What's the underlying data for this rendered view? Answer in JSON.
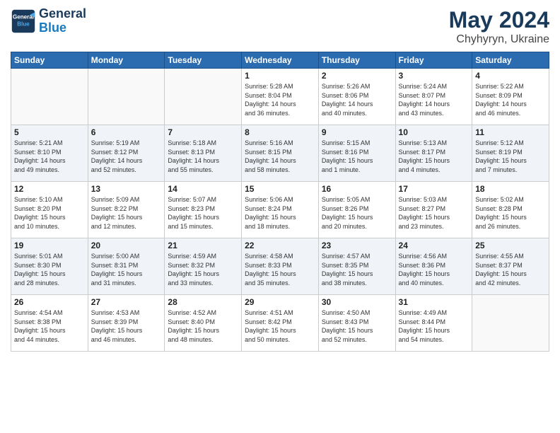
{
  "header": {
    "logo_line1": "General",
    "logo_line2": "Blue",
    "month_year": "May 2024",
    "location": "Chyhyryn, Ukraine"
  },
  "weekdays": [
    "Sunday",
    "Monday",
    "Tuesday",
    "Wednesday",
    "Thursday",
    "Friday",
    "Saturday"
  ],
  "weeks": [
    [
      {
        "day": "",
        "info": ""
      },
      {
        "day": "",
        "info": ""
      },
      {
        "day": "",
        "info": ""
      },
      {
        "day": "1",
        "info": "Sunrise: 5:28 AM\nSunset: 8:04 PM\nDaylight: 14 hours\nand 36 minutes."
      },
      {
        "day": "2",
        "info": "Sunrise: 5:26 AM\nSunset: 8:06 PM\nDaylight: 14 hours\nand 40 minutes."
      },
      {
        "day": "3",
        "info": "Sunrise: 5:24 AM\nSunset: 8:07 PM\nDaylight: 14 hours\nand 43 minutes."
      },
      {
        "day": "4",
        "info": "Sunrise: 5:22 AM\nSunset: 8:09 PM\nDaylight: 14 hours\nand 46 minutes."
      }
    ],
    [
      {
        "day": "5",
        "info": "Sunrise: 5:21 AM\nSunset: 8:10 PM\nDaylight: 14 hours\nand 49 minutes."
      },
      {
        "day": "6",
        "info": "Sunrise: 5:19 AM\nSunset: 8:12 PM\nDaylight: 14 hours\nand 52 minutes."
      },
      {
        "day": "7",
        "info": "Sunrise: 5:18 AM\nSunset: 8:13 PM\nDaylight: 14 hours\nand 55 minutes."
      },
      {
        "day": "8",
        "info": "Sunrise: 5:16 AM\nSunset: 8:15 PM\nDaylight: 14 hours\nand 58 minutes."
      },
      {
        "day": "9",
        "info": "Sunrise: 5:15 AM\nSunset: 8:16 PM\nDaylight: 15 hours\nand 1 minute."
      },
      {
        "day": "10",
        "info": "Sunrise: 5:13 AM\nSunset: 8:17 PM\nDaylight: 15 hours\nand 4 minutes."
      },
      {
        "day": "11",
        "info": "Sunrise: 5:12 AM\nSunset: 8:19 PM\nDaylight: 15 hours\nand 7 minutes."
      }
    ],
    [
      {
        "day": "12",
        "info": "Sunrise: 5:10 AM\nSunset: 8:20 PM\nDaylight: 15 hours\nand 10 minutes."
      },
      {
        "day": "13",
        "info": "Sunrise: 5:09 AM\nSunset: 8:22 PM\nDaylight: 15 hours\nand 12 minutes."
      },
      {
        "day": "14",
        "info": "Sunrise: 5:07 AM\nSunset: 8:23 PM\nDaylight: 15 hours\nand 15 minutes."
      },
      {
        "day": "15",
        "info": "Sunrise: 5:06 AM\nSunset: 8:24 PM\nDaylight: 15 hours\nand 18 minutes."
      },
      {
        "day": "16",
        "info": "Sunrise: 5:05 AM\nSunset: 8:26 PM\nDaylight: 15 hours\nand 20 minutes."
      },
      {
        "day": "17",
        "info": "Sunrise: 5:03 AM\nSunset: 8:27 PM\nDaylight: 15 hours\nand 23 minutes."
      },
      {
        "day": "18",
        "info": "Sunrise: 5:02 AM\nSunset: 8:28 PM\nDaylight: 15 hours\nand 26 minutes."
      }
    ],
    [
      {
        "day": "19",
        "info": "Sunrise: 5:01 AM\nSunset: 8:30 PM\nDaylight: 15 hours\nand 28 minutes."
      },
      {
        "day": "20",
        "info": "Sunrise: 5:00 AM\nSunset: 8:31 PM\nDaylight: 15 hours\nand 31 minutes."
      },
      {
        "day": "21",
        "info": "Sunrise: 4:59 AM\nSunset: 8:32 PM\nDaylight: 15 hours\nand 33 minutes."
      },
      {
        "day": "22",
        "info": "Sunrise: 4:58 AM\nSunset: 8:33 PM\nDaylight: 15 hours\nand 35 minutes."
      },
      {
        "day": "23",
        "info": "Sunrise: 4:57 AM\nSunset: 8:35 PM\nDaylight: 15 hours\nand 38 minutes."
      },
      {
        "day": "24",
        "info": "Sunrise: 4:56 AM\nSunset: 8:36 PM\nDaylight: 15 hours\nand 40 minutes."
      },
      {
        "day": "25",
        "info": "Sunrise: 4:55 AM\nSunset: 8:37 PM\nDaylight: 15 hours\nand 42 minutes."
      }
    ],
    [
      {
        "day": "26",
        "info": "Sunrise: 4:54 AM\nSunset: 8:38 PM\nDaylight: 15 hours\nand 44 minutes."
      },
      {
        "day": "27",
        "info": "Sunrise: 4:53 AM\nSunset: 8:39 PM\nDaylight: 15 hours\nand 46 minutes."
      },
      {
        "day": "28",
        "info": "Sunrise: 4:52 AM\nSunset: 8:40 PM\nDaylight: 15 hours\nand 48 minutes."
      },
      {
        "day": "29",
        "info": "Sunrise: 4:51 AM\nSunset: 8:42 PM\nDaylight: 15 hours\nand 50 minutes."
      },
      {
        "day": "30",
        "info": "Sunrise: 4:50 AM\nSunset: 8:43 PM\nDaylight: 15 hours\nand 52 minutes."
      },
      {
        "day": "31",
        "info": "Sunrise: 4:49 AM\nSunset: 8:44 PM\nDaylight: 15 hours\nand 54 minutes."
      },
      {
        "day": "",
        "info": ""
      }
    ]
  ]
}
